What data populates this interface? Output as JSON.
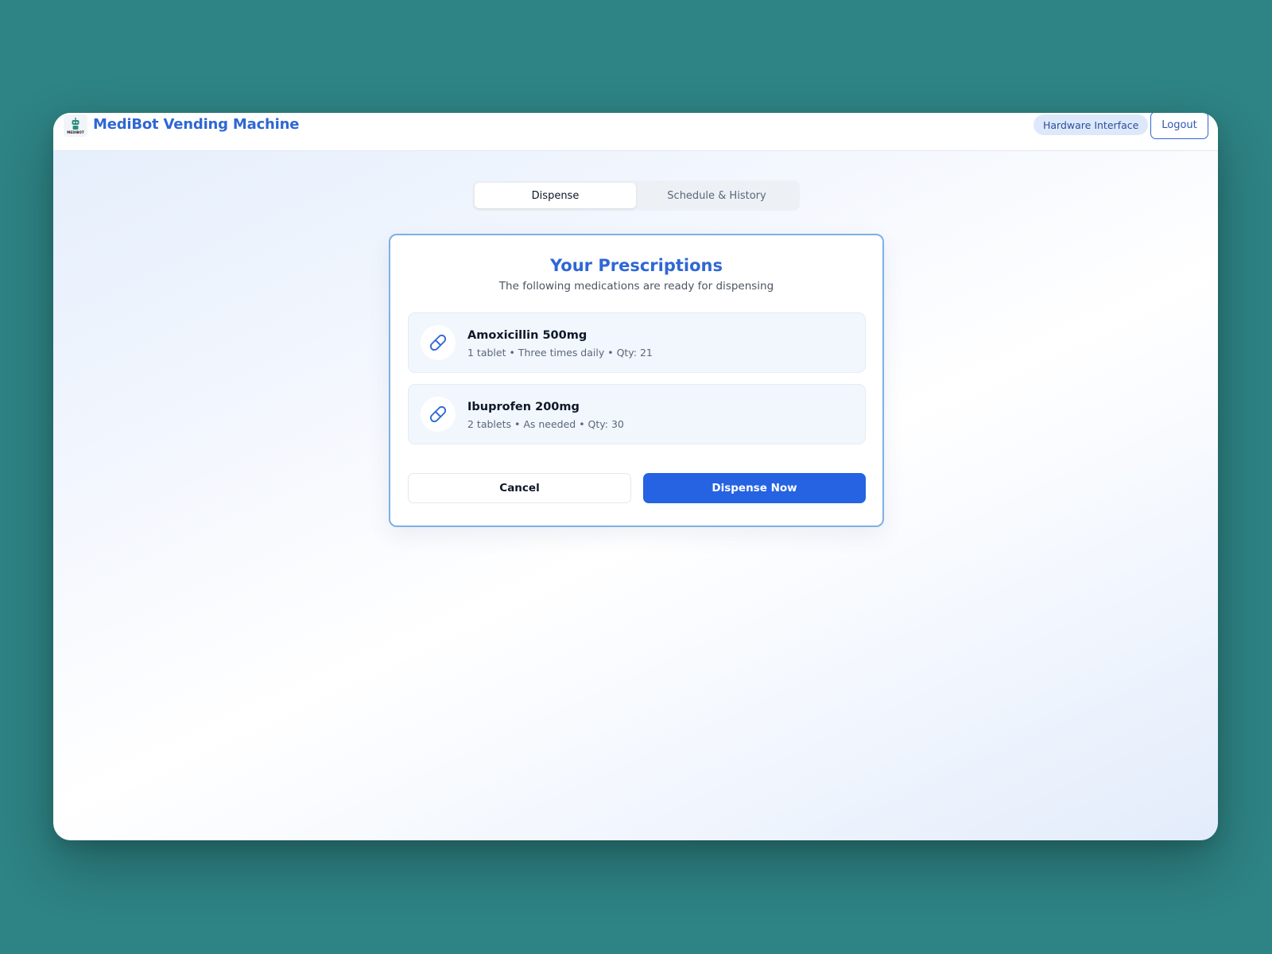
{
  "header": {
    "logo_text": "MEDIBOT",
    "app_title": "MediBot Vending Machine",
    "hardware_badge": "Hardware Interface",
    "logout_label": "Logout"
  },
  "tabs": [
    {
      "label": "Dispense",
      "active": true
    },
    {
      "label": "Schedule & History",
      "active": false
    }
  ],
  "prescriptions": {
    "title": "Your Prescriptions",
    "subtitle": "The following medications are ready for dispensing",
    "items": [
      {
        "name": "Amoxicillin 500mg",
        "details": "1 tablet • Three times daily • Qty: 21",
        "icon": "pill-icon"
      },
      {
        "name": "Ibuprofen 200mg",
        "details": "2 tablets • As needed • Qty: 30",
        "icon": "pill-icon"
      }
    ],
    "cancel_label": "Cancel",
    "dispense_label": "Dispense Now"
  },
  "colors": {
    "background": "#2e8384",
    "accent": "#2f67d4",
    "primary_button": "#2563e3",
    "card_border": "#7fb0e4"
  }
}
